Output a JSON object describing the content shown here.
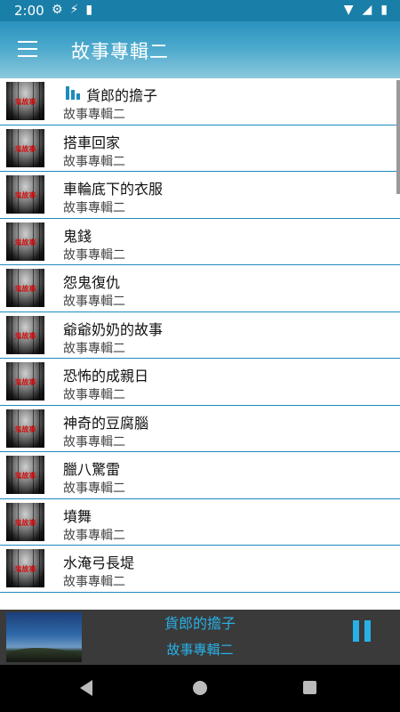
{
  "status_bar": {
    "time": "2:00",
    "icons": [
      "gear-icon",
      "accessibility-icon",
      "sdcard-icon",
      "wifi-icon",
      "signal-icon",
      "battery-icon"
    ]
  },
  "toolbar": {
    "title": "故事專輯二"
  },
  "list": {
    "items": [
      {
        "title": "貨郎的擔子",
        "subtitle": "故事專輯二",
        "playing": true
      },
      {
        "title": "搭車回家",
        "subtitle": "故事專輯二"
      },
      {
        "title": "車輪底下的衣服",
        "subtitle": "故事專輯二"
      },
      {
        "title": "鬼錢",
        "subtitle": "故事專輯二"
      },
      {
        "title": "怨鬼復仇",
        "subtitle": "故事專輯二"
      },
      {
        "title": "爺爺奶奶的故事",
        "subtitle": "故事專輯二"
      },
      {
        "title": "恐怖的成親日",
        "subtitle": "故事專輯二"
      },
      {
        "title": "神奇的豆腐腦",
        "subtitle": "故事專輯二"
      },
      {
        "title": "臘八驚雷",
        "subtitle": "故事專輯二"
      },
      {
        "title": "墳舞",
        "subtitle": "故事專輯二"
      },
      {
        "title": "水淹弓長堤",
        "subtitle": "故事專輯二"
      }
    ],
    "thumb_text": "鬼故事"
  },
  "player": {
    "title": "貨郎的擔子",
    "album": "故事專輯二"
  },
  "colors": {
    "accent": "#1d8bbd",
    "player_text": "#29b0e6",
    "toolbar": "#2a92bf"
  }
}
